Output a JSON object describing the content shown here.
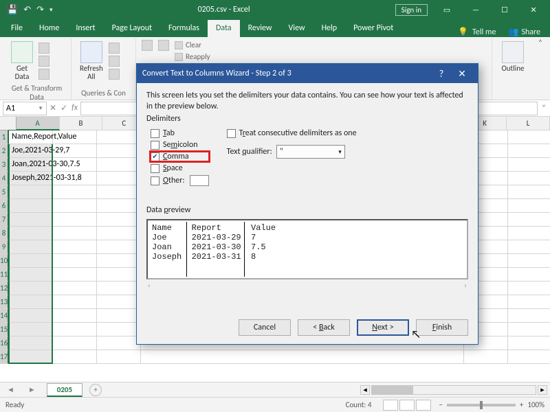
{
  "titlebar": {
    "doc": "0205.csv - Excel",
    "sign_in": "Sign in"
  },
  "tabs": {
    "file": "File",
    "home": "Home",
    "insert": "Insert",
    "pagelayout": "Page Layout",
    "formulas": "Formulas",
    "data": "Data",
    "review": "Review",
    "view": "View",
    "help": "Help",
    "powerpivot": "Power Pivot",
    "tell": "Tell me",
    "share": "Share"
  },
  "ribbon": {
    "get_data": "Get\nData",
    "refresh_all": "Refresh\nAll",
    "g1": "Get & Transform Data",
    "g2": "Queries & Con",
    "clear": "Clear",
    "reapply": "Reapply",
    "outline": "Outline"
  },
  "namebox": "A1",
  "colheads": [
    "A",
    "B",
    "C",
    "K",
    "L"
  ],
  "rows": [
    {
      "a": "Name,Report,Value"
    },
    {
      "a": "Joe,2021-03-29,7"
    },
    {
      "a": "Joan,2021-03-30,7.5"
    },
    {
      "a": "Joseph,2021-03-31,8"
    }
  ],
  "sheet": "0205",
  "status": {
    "ready": "Ready",
    "count": "Count: 4",
    "zoom": "100%"
  },
  "dialog": {
    "title": "Convert Text to Columns Wizard - Step 2 of 3",
    "intro": "This screen lets you set the delimiters your data contains.  You can see how your text is affected in the preview below.",
    "delim_label": "Delimiters",
    "tab": "Tab",
    "semicolon": "Semicolon",
    "comma": "Comma",
    "space": "Space",
    "other": "Other:",
    "treat": "Treat consecutive delimiters as one",
    "qual_label": "Text qualifier:",
    "qual_value": "\"",
    "preview_label": "Data preview",
    "preview_headers": "Name    Report      Value",
    "preview_r1": "Joe     2021-03-29  7",
    "preview_r2": "Joan    2021-03-30  7.5",
    "preview_r3": "Joseph  2021-03-31  8",
    "cancel": "Cancel",
    "back": "Back",
    "next": "Next >",
    "finish": "Finish"
  }
}
